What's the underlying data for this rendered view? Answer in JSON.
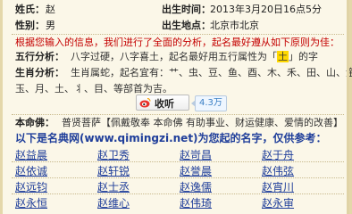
{
  "info": {
    "surname_label": "姓氏：",
    "surname_value": "赵",
    "gender_label": "性别：",
    "gender_value": "男",
    "birth_time_label": "出生时间：",
    "birth_time_value": "2013年3月20日16点5分",
    "birth_place_label": "出生地点：",
    "birth_place_value": "北京市北京"
  },
  "notice": "根据您输入的信息，我们进行了全面的分析，起名最好遵从如下原则为佳：",
  "wuxing": {
    "label": "五行分析：",
    "text_before": "八字过硬，八字喜土，起名最好用五行属性为「",
    "element": "土",
    "text_after": "」的字"
  },
  "zodiac": {
    "label": "生肖分析：",
    "line1": "生肖属蛇，起名宜有：艹、虫、豆、鱼、酉、木、禾、田、山、金、",
    "line2": "玉、月、土、丬、目、等部首为吉。"
  },
  "favorite": {
    "label": "收听",
    "count": "4.3万"
  },
  "mingfo": {
    "label": "本命佛：",
    "text": "普贤菩萨【佩戴敬奉 本命佛 有助事业、财运健康、爱情的改善】"
  },
  "heading": "以下是名典网(www.qimingzi.net)为您起的名字，仅供参考：",
  "names": [
    [
      "赵益晨",
      "赵卫秀",
      "赵岢昌",
      "赵于舟"
    ],
    [
      "赵依诚",
      "赵轩锐",
      "赵誉晨",
      "赵伟弦"
    ],
    [
      "赵远钧",
      "赵士丞",
      "赵逸儒",
      "赵宵川"
    ],
    [
      "赵永恒",
      "赵维心",
      "赵伟琦",
      "赵永审"
    ]
  ]
}
